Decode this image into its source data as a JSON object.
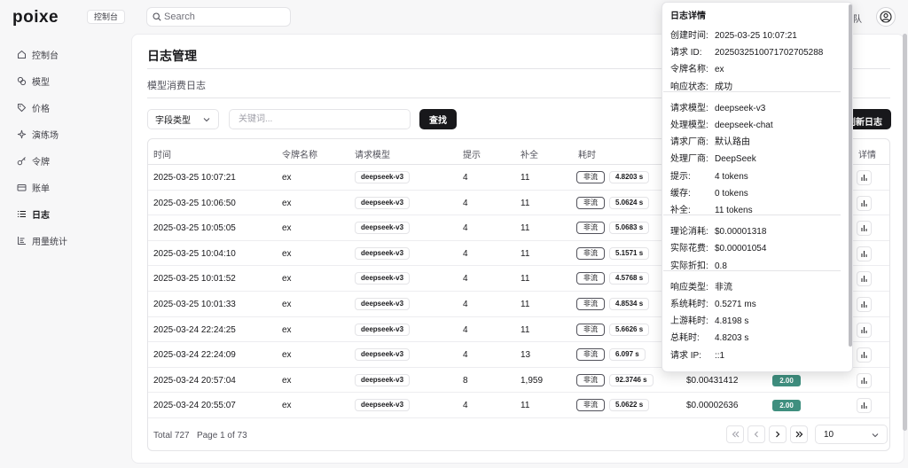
{
  "app": {
    "logo": "poixe",
    "workspace": "控制台",
    "search_placeholder": "Search",
    "team_text": "队"
  },
  "sidebar": {
    "items": [
      {
        "label": "控制台",
        "icon": "home-icon"
      },
      {
        "label": "模型",
        "icon": "models-icon"
      },
      {
        "label": "价格",
        "icon": "tag-icon"
      },
      {
        "label": "演练场",
        "icon": "sparkles-icon"
      },
      {
        "label": "令牌",
        "icon": "key-icon"
      },
      {
        "label": "账单",
        "icon": "wallet-icon"
      },
      {
        "label": "日志",
        "icon": "list-icon",
        "active": true
      },
      {
        "label": "用量统计",
        "icon": "chart-icon"
      }
    ]
  },
  "page": {
    "title": "日志管理",
    "subtitle": "模型消费日志"
  },
  "filters": {
    "field_type": "字段类型",
    "keyword_placeholder": "关键词...",
    "search_label": "查找",
    "refresh_label": "刷新日志"
  },
  "table": {
    "columns": [
      "时间",
      "令牌名称",
      "请求模型",
      "提示",
      "补全",
      "耗时",
      "",
      "",
      "详情"
    ],
    "rows": [
      {
        "time": "2025-03-25 10:07:21",
        "token": "ex",
        "model": "deepseek-v3",
        "prompt": "4",
        "completion": "11",
        "stream": "非流",
        "duration": "4.8203 s",
        "cost": "",
        "ratio": ""
      },
      {
        "time": "2025-03-25 10:06:50",
        "token": "ex",
        "model": "deepseek-v3",
        "prompt": "4",
        "completion": "11",
        "stream": "非流",
        "duration": "5.0624 s",
        "cost": "",
        "ratio": ""
      },
      {
        "time": "2025-03-25 10:05:05",
        "token": "ex",
        "model": "deepseek-v3",
        "prompt": "4",
        "completion": "11",
        "stream": "非流",
        "duration": "5.0683 s",
        "cost": "",
        "ratio": ""
      },
      {
        "time": "2025-03-25 10:04:10",
        "token": "ex",
        "model": "deepseek-v3",
        "prompt": "4",
        "completion": "11",
        "stream": "非流",
        "duration": "5.1571 s",
        "cost": "",
        "ratio": ""
      },
      {
        "time": "2025-03-25 10:01:52",
        "token": "ex",
        "model": "deepseek-v3",
        "prompt": "4",
        "completion": "11",
        "stream": "非流",
        "duration": "4.5768 s",
        "cost": "",
        "ratio": ""
      },
      {
        "time": "2025-03-25 10:01:33",
        "token": "ex",
        "model": "deepseek-v3",
        "prompt": "4",
        "completion": "11",
        "stream": "非流",
        "duration": "4.8534 s",
        "cost": "",
        "ratio": ""
      },
      {
        "time": "2025-03-24 22:24:25",
        "token": "ex",
        "model": "deepseek-v3",
        "prompt": "4",
        "completion": "11",
        "stream": "非流",
        "duration": "5.6626 s",
        "cost": "",
        "ratio": ""
      },
      {
        "time": "2025-03-24 22:24:09",
        "token": "ex",
        "model": "deepseek-v3",
        "prompt": "4",
        "completion": "13",
        "stream": "非流",
        "duration": "6.097 s",
        "cost": "",
        "ratio": ""
      },
      {
        "time": "2025-03-24 20:57:04",
        "token": "ex",
        "model": "deepseek-v3",
        "prompt": "8",
        "completion": "1,959",
        "stream": "非流",
        "duration": "92.3746 s",
        "cost": "$0.00431412",
        "ratio": "2.00"
      },
      {
        "time": "2025-03-24 20:55:07",
        "token": "ex",
        "model": "deepseek-v3",
        "prompt": "4",
        "completion": "11",
        "stream": "非流",
        "duration": "5.0622 s",
        "cost": "$0.00002636",
        "ratio": "2.00"
      }
    ]
  },
  "pagination": {
    "total": "Total 727",
    "page": "Page 1 of 73",
    "page_size": "10"
  },
  "detail": {
    "title": "日志详情",
    "groups": [
      [
        {
          "k": "创建时间:",
          "v": "2025-03-25 10:07:21"
        },
        {
          "k": "请求 ID:",
          "v": "20250325100717027052​88"
        },
        {
          "k": "令牌名称:",
          "v": "ex"
        },
        {
          "k": "响应状态:",
          "v": "成功"
        }
      ],
      [
        {
          "k": "请求模型:",
          "v": "deepseek-v3"
        },
        {
          "k": "处理模型:",
          "v": "deepseek-chat"
        },
        {
          "k": "请求厂商:",
          "v": "默认路由"
        },
        {
          "k": "处理厂商:",
          "v": "DeepSeek"
        },
        {
          "k": "提示:",
          "v": "4 tokens"
        },
        {
          "k": "缓存:",
          "v": "0 tokens"
        },
        {
          "k": "补全:",
          "v": "11 tokens"
        }
      ],
      [
        {
          "k": "理论消耗:",
          "v": "$0.00001318"
        },
        {
          "k": "实际花费:",
          "v": "$0.00001054"
        },
        {
          "k": "实际折扣:",
          "v": "0.8"
        }
      ],
      [
        {
          "k": "响应类型:",
          "v": "非流"
        },
        {
          "k": "系统耗时:",
          "v": "0.5271 ms"
        },
        {
          "k": "上游耗时:",
          "v": "4.8198 s"
        },
        {
          "k": "总耗时:",
          "v": "4.8203 s"
        },
        {
          "k": "请求 IP:",
          "v": "::1"
        }
      ]
    ]
  },
  "colors": {
    "primary": "#18181b",
    "ratio_badge": "#3f8f7f",
    "border": "#e4e4e7"
  }
}
